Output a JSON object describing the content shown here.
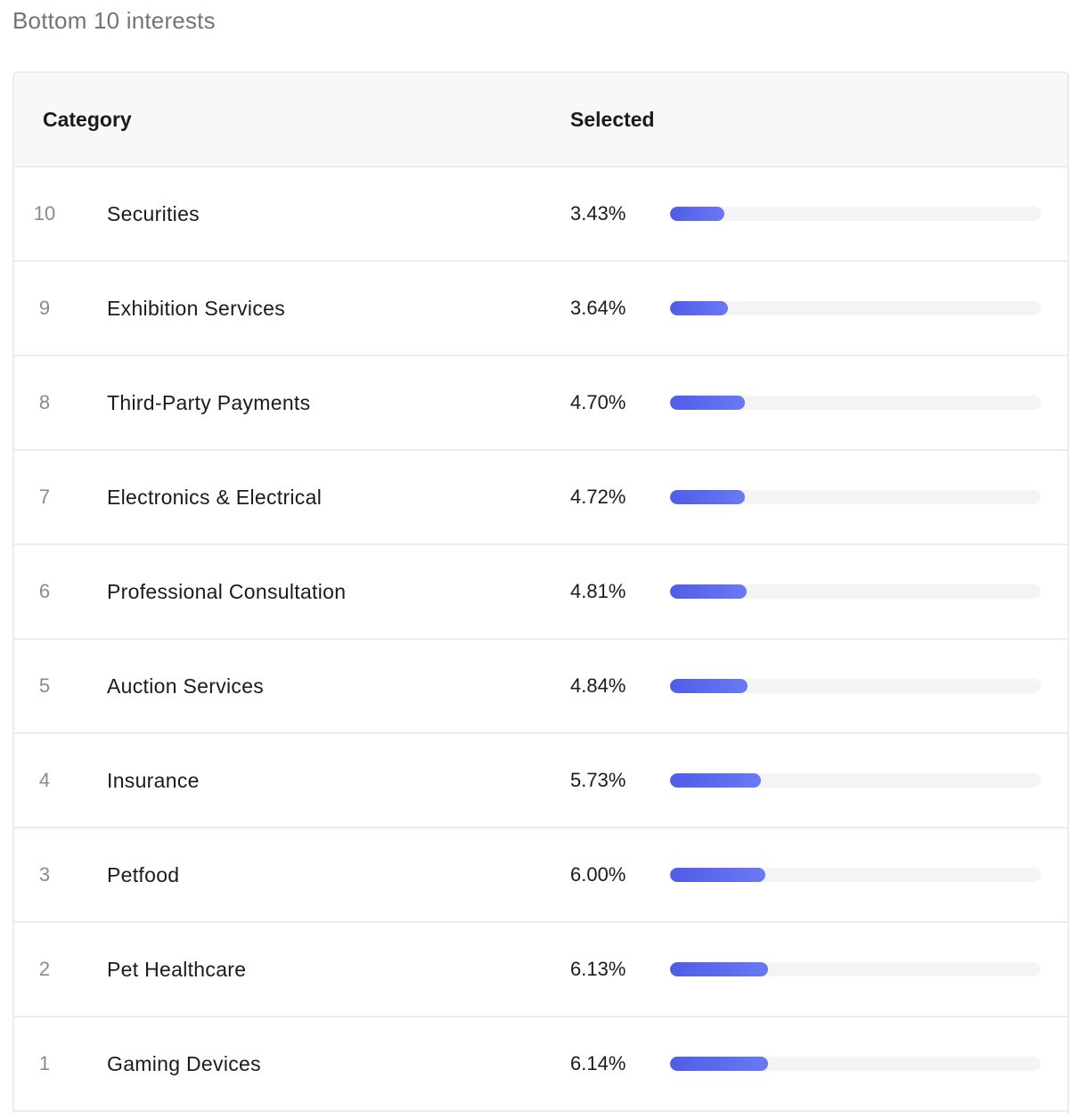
{
  "title": "Bottom 10 interests",
  "columns": {
    "category": "Category",
    "selected": "Selected"
  },
  "accent_color": "#5866ec",
  "rows": [
    {
      "rank": "10",
      "category": "Securities",
      "selected": "3.43%",
      "fraction": 0.0343
    },
    {
      "rank": "9",
      "category": "Exhibition Services",
      "selected": "3.64%",
      "fraction": 0.0364
    },
    {
      "rank": "8",
      "category": "Third-Party Payments",
      "selected": "4.70%",
      "fraction": 0.047
    },
    {
      "rank": "7",
      "category": "Electronics & Electrical",
      "selected": "4.72%",
      "fraction": 0.0472
    },
    {
      "rank": "6",
      "category": "Professional Consultation",
      "selected": "4.81%",
      "fraction": 0.0481
    },
    {
      "rank": "5",
      "category": "Auction Services",
      "selected": "4.84%",
      "fraction": 0.0484
    },
    {
      "rank": "4",
      "category": "Insurance",
      "selected": "5.73%",
      "fraction": 0.0573
    },
    {
      "rank": "3",
      "category": "Petfood",
      "selected": "6.00%",
      "fraction": 0.06
    },
    {
      "rank": "2",
      "category": "Pet Healthcare",
      "selected": "6.13%",
      "fraction": 0.0613
    },
    {
      "rank": "1",
      "category": "Gaming Devices",
      "selected": "6.14%",
      "fraction": 0.0614
    }
  ]
}
